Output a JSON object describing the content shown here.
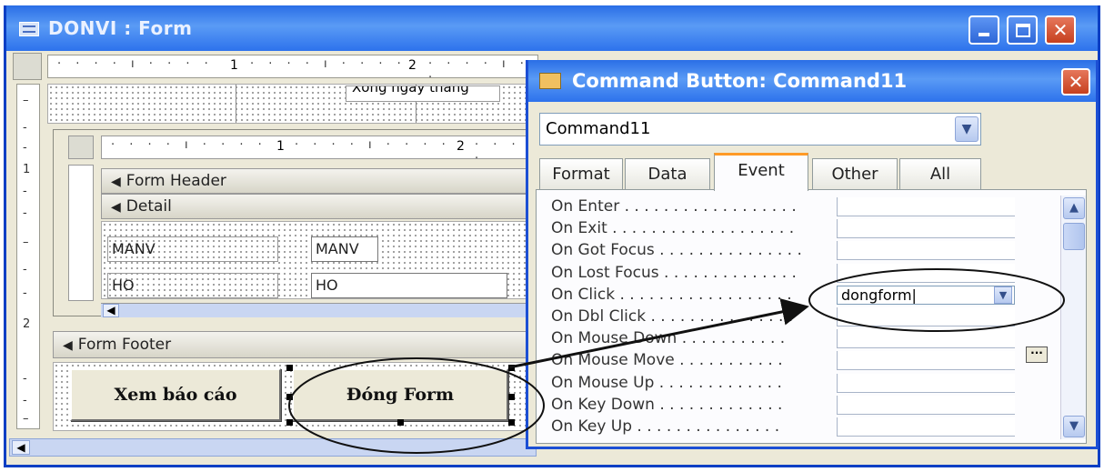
{
  "window": {
    "title": "DONVI : Form",
    "min_icon": "minimize-icon",
    "max_icon": "maximize-icon",
    "close_icon": "close-icon"
  },
  "ruler": {
    "marks": [
      "1",
      "2"
    ],
    "left_marks": [
      "1",
      "2"
    ]
  },
  "cut_label": "Xong ngày tháng",
  "subform": {
    "ruler_marks": [
      "1",
      "2"
    ],
    "form_header": "Form Header",
    "detail": "Detail",
    "fields": [
      {
        "label": "MANV",
        "control": "MANV"
      },
      {
        "label": "HO",
        "control": "HO"
      }
    ]
  },
  "form_footer": "Form Footer",
  "buttons": {
    "report": "Xem báo cáo",
    "close_form": "Đóng Form"
  },
  "property_sheet": {
    "title": "Command Button: Command11",
    "selector": "Command11",
    "tabs": [
      "Format",
      "Data",
      "Event",
      "Other",
      "All"
    ],
    "active_tab": "Event",
    "events": [
      {
        "label": "On Enter",
        "value": ""
      },
      {
        "label": "On Exit",
        "value": ""
      },
      {
        "label": "On Got Focus",
        "value": ""
      },
      {
        "label": "On Lost Focus",
        "value": ""
      },
      {
        "label": "On Click",
        "value": "dongform"
      },
      {
        "label": "On Dbl Click",
        "value": ""
      },
      {
        "label": "On Mouse Down",
        "value": ""
      },
      {
        "label": "On Mouse Move",
        "value": ""
      },
      {
        "label": "On Mouse Up",
        "value": ""
      },
      {
        "label": "On Key Down",
        "value": ""
      },
      {
        "label": "On Key Up",
        "value": ""
      }
    ]
  },
  "colors": {
    "titlebar": "#2a6ee6",
    "close": "#c6401f",
    "tab_highlight": "#ff9a26",
    "face": "#ece9d8"
  }
}
